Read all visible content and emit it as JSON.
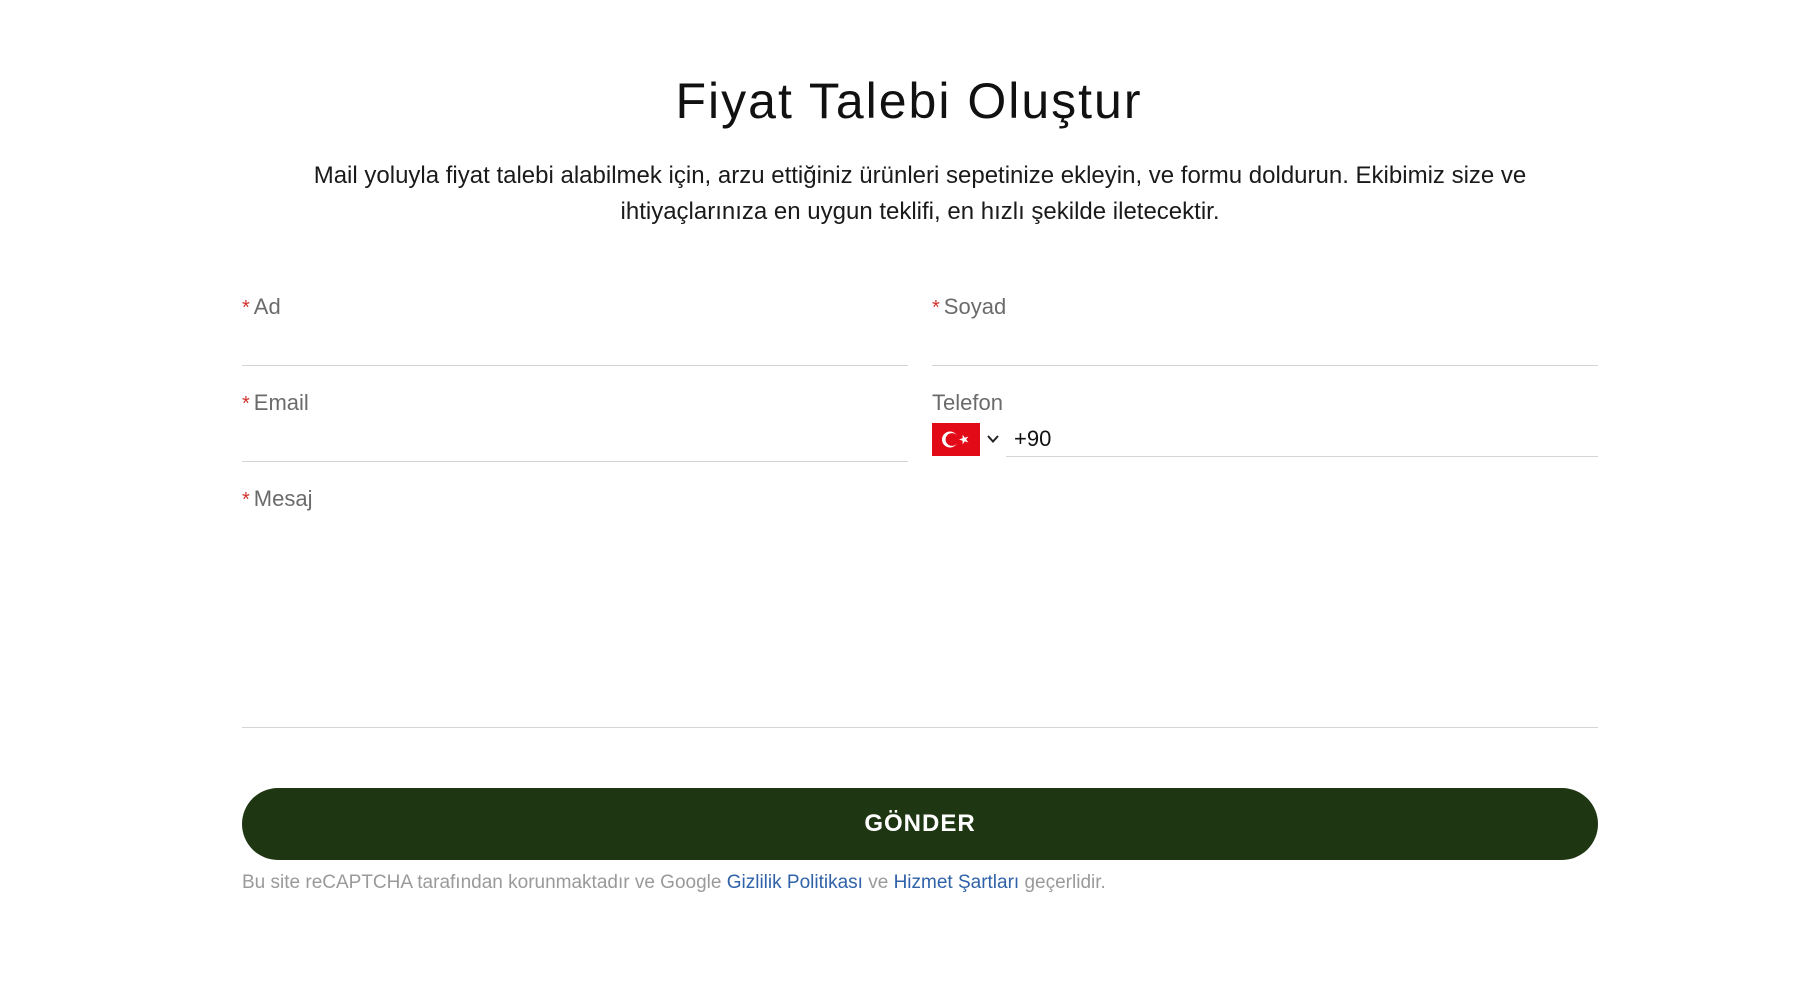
{
  "page": {
    "title": "Fiyat Talebi Oluştur",
    "intro": "Mail yoluyla fiyat talebi alabilmek için, arzu ettiğiniz ürünleri sepetinize ekleyin, ve formu doldurun. Ekibimiz size ve ihtiyaçlarınıza en uygun teklifi, en hızlı şekilde iletecektir."
  },
  "form": {
    "required_mark": "*",
    "ad": {
      "label": "Ad",
      "value": ""
    },
    "soyad": {
      "label": "Soyad",
      "value": ""
    },
    "email": {
      "label": "Email",
      "value": ""
    },
    "telefon": {
      "label": "Telefon",
      "country_code": "+90",
      "country_icon": "turkey-flag-icon"
    },
    "mesaj": {
      "label": "Mesaj",
      "value": ""
    },
    "submit_label": "GÖNDER"
  },
  "recaptcha": {
    "text_before": "Bu site reCAPTCHA tarafından korunmaktadır ve Google ",
    "privacy_link": "Gizlilik Politikası",
    "text_middle": " ve ",
    "terms_link": "Hizmet Şartları",
    "text_after": " geçerlidir."
  },
  "colors": {
    "button_bg": "#1f3613",
    "required": "#d0312d",
    "link": "#2f62a8",
    "flag_red": "#e30a17"
  }
}
